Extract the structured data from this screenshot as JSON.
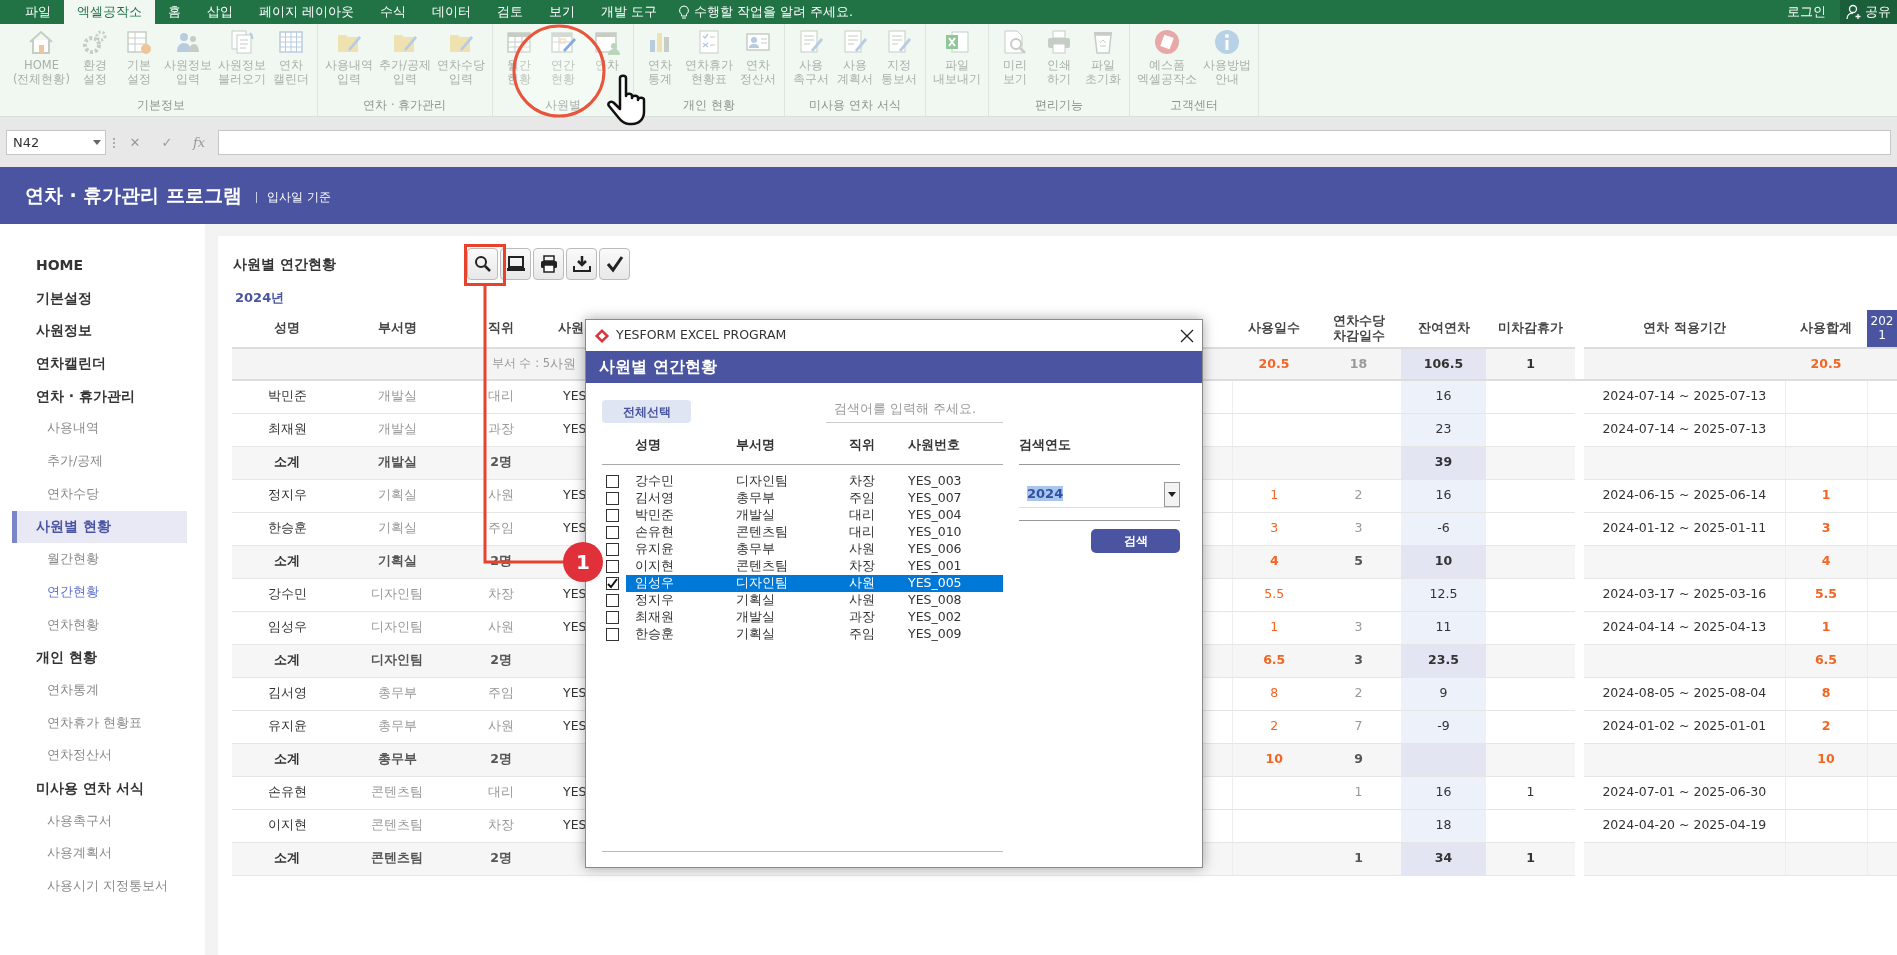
{
  "menu_bar": {
    "tabs": [
      {
        "label": "파일",
        "selected": false
      },
      {
        "label": "엑셀공작소",
        "selected": true
      },
      {
        "label": "홈",
        "selected": false
      },
      {
        "label": "삽입",
        "selected": false
      },
      {
        "label": "페이지 레이아웃",
        "selected": false
      },
      {
        "label": "수식",
        "selected": false
      },
      {
        "label": "데이터",
        "selected": false
      },
      {
        "label": "검토",
        "selected": false
      },
      {
        "label": "보기",
        "selected": false
      },
      {
        "label": "개발 도구",
        "selected": false
      }
    ],
    "tell_me": "수행할 작업을 알려 주세요.",
    "login": "로그인",
    "share": "공유"
  },
  "ribbon": {
    "groups": [
      {
        "label": "기본정보",
        "items": [
          {
            "label": "HOME\n(전체현황)"
          },
          {
            "label": "환경\n설정"
          },
          {
            "label": "기본\n설정"
          },
          {
            "label": "사원정보\n입력"
          },
          {
            "label": "사원정보\n불러오기"
          },
          {
            "label": "연차\n캘린더"
          }
        ]
      },
      {
        "label": "연차 · 휴가관리",
        "items": [
          {
            "label": "사용내역\n입력"
          },
          {
            "label": "추가/공제\n입력"
          },
          {
            "label": "연차수당\n입력"
          }
        ]
      },
      {
        "label": "사원별",
        "items": [
          {
            "label": "월간\n현황"
          },
          {
            "label": "연간\n현황"
          },
          {
            "label": "연차"
          }
        ]
      },
      {
        "label": "개인 현황",
        "items": [
          {
            "label": "연차\n통계"
          },
          {
            "label": "연차휴가\n현황표"
          },
          {
            "label": "연차\n정산서"
          }
        ]
      },
      {
        "label": "미사용 연차 서식",
        "items": [
          {
            "label": "사용\n촉구서"
          },
          {
            "label": "사용\n계획서"
          },
          {
            "label": "지정\n통보서"
          }
        ]
      },
      {
        "items": [
          {
            "label": "파일\n내보내기"
          }
        ]
      },
      {
        "label": "편리기능",
        "items": [
          {
            "label": "미리\n보기"
          },
          {
            "label": "인쇄\n하기"
          },
          {
            "label": "파일\n초기화"
          }
        ]
      },
      {
        "label": "고객센터",
        "items": [
          {
            "label": "예스폼\n엑셀공작소"
          },
          {
            "label": "사용방법\n안내"
          }
        ]
      }
    ]
  },
  "formula_bar": {
    "name_box": "N42",
    "cancel": "✕",
    "enter": "✓",
    "function": "fx"
  },
  "header": {
    "title": "연차 · 휴가관리 프로그램",
    "subtitle": "입사일 기준"
  },
  "sidebar": {
    "items": [
      {
        "label": "HOME",
        "selected": false
      },
      {
        "label": "기본설정",
        "selected": false
      },
      {
        "label": "사원정보",
        "selected": false
      },
      {
        "label": "연차캘린더",
        "selected": false
      },
      {
        "label": "연차 · 휴가관리",
        "selected": false,
        "children": [
          {
            "label": "사용내역",
            "selected": false
          },
          {
            "label": "추가/공제",
            "selected": false
          },
          {
            "label": "연차수당",
            "selected": false
          }
        ]
      },
      {
        "label": "사원별 현황",
        "selected": true,
        "children": [
          {
            "label": "월간현황",
            "selected": false
          },
          {
            "label": "연간현황",
            "selected": true
          },
          {
            "label": "연차현황",
            "selected": false
          }
        ]
      },
      {
        "label": "개인 현황",
        "selected": false,
        "children": [
          {
            "label": "연차통계",
            "selected": false
          },
          {
            "label": "연차휴가 현황표",
            "selected": false
          },
          {
            "label": "연차정산서",
            "selected": false
          }
        ]
      },
      {
        "label": "미사용 연차 서식",
        "selected": false,
        "children": [
          {
            "label": "사용촉구서",
            "selected": false
          },
          {
            "label": "사용계획서",
            "selected": false
          },
          {
            "label": "사용시기 지정통보서",
            "selected": false
          }
        ]
      }
    ]
  },
  "page": {
    "title": "사원별 연간현황",
    "year": "2024년"
  },
  "table": {
    "columns": [
      {
        "label": "성명"
      },
      {
        "label": "부서명"
      },
      {
        "label": "직위"
      },
      {
        "label": "사원"
      },
      {
        "label": "사용일수"
      },
      {
        "label": "연차수당\n차감일수"
      },
      {
        "label": "잔여연차"
      },
      {
        "label": "미차감휴가"
      },
      {
        "label": "연차 적용기간"
      },
      {
        "label": "사용합계"
      },
      {
        "label": "202\n1"
      }
    ],
    "summary": {
      "dept_count": "부서 수 : 5",
      "emp_count": "사원",
      "used": "20.5",
      "allowance": "18",
      "remaining": "106.5",
      "undeducted": "1",
      "total": "20.5"
    },
    "rows": [
      {
        "kind": "employee",
        "name": "박민준",
        "dept": "개발실",
        "position": "대리",
        "emp_no": "YES",
        "remaining": "16",
        "period": "2024-07-14 ~ 2025-07-13"
      },
      {
        "kind": "employee",
        "name": "최재원",
        "dept": "개발실",
        "position": "과장",
        "emp_no": "YES",
        "remaining": "23",
        "period": "2024-07-14 ~ 2025-07-13"
      },
      {
        "kind": "subtotal",
        "name": "소계",
        "dept": "개발실",
        "position": "2명",
        "remaining": "39"
      },
      {
        "kind": "employee",
        "name": "정지우",
        "dept": "기획실",
        "position": "사원",
        "emp_no": "YES",
        "used": "1",
        "allowance": "2",
        "remaining": "16",
        "period": "2024-06-15 ~ 2025-06-14",
        "total": "1"
      },
      {
        "kind": "employee",
        "name": "한승훈",
        "dept": "기획실",
        "position": "주임",
        "emp_no": "YES",
        "used": "3",
        "allowance": "3",
        "remaining": "-6",
        "period": "2024-01-12 ~ 2025-01-11",
        "total": "3"
      },
      {
        "kind": "subtotal",
        "name": "소계",
        "dept": "기획실",
        "position": "2명",
        "used": "4",
        "allowance": "5",
        "remaining": "10",
        "total": "4"
      },
      {
        "kind": "employee",
        "name": "강수민",
        "dept": "디자인팀",
        "position": "차장",
        "emp_no": "YES",
        "used": "5.5",
        "remaining": "12.5",
        "period": "2024-03-17 ~ 2025-03-16",
        "total": "5.5"
      },
      {
        "kind": "employee",
        "name": "임성우",
        "dept": "디자인팀",
        "position": "사원",
        "emp_no": "YES",
        "used": "1",
        "allowance": "3",
        "remaining": "11",
        "period": "2024-04-14 ~ 2025-04-13",
        "total": "1"
      },
      {
        "kind": "subtotal",
        "name": "소계",
        "dept": "디자인팀",
        "position": "2명",
        "used": "6.5",
        "allowance": "3",
        "remaining": "23.5",
        "total": "6.5"
      },
      {
        "kind": "employee",
        "name": "김서영",
        "dept": "총무부",
        "position": "주임",
        "emp_no": "YES",
        "used": "8",
        "allowance": "2",
        "remaining": "9",
        "period": "2024-08-05 ~ 2025-08-04",
        "total": "8"
      },
      {
        "kind": "employee",
        "name": "유지윤",
        "dept": "총무부",
        "position": "사원",
        "emp_no": "YES",
        "used": "2",
        "allowance": "7",
        "remaining": "-9",
        "period": "2024-01-02 ~ 2025-01-01",
        "total": "2"
      },
      {
        "kind": "subtotal",
        "name": "소계",
        "dept": "총무부",
        "position": "2명",
        "used": "10",
        "allowance": "9",
        "total": "10"
      },
      {
        "kind": "employee",
        "name": "손유현",
        "dept": "콘텐츠팀",
        "position": "대리",
        "emp_no": "YES",
        "allowance": "1",
        "remaining": "16",
        "undeducted": "1",
        "period": "2024-07-01 ~ 2025-06-30"
      },
      {
        "kind": "employee",
        "name": "이지현",
        "dept": "콘텐츠팀",
        "position": "차장",
        "emp_no": "YES",
        "remaining": "18",
        "period": "2024-04-20 ~ 2025-04-19"
      },
      {
        "kind": "subtotal",
        "name": "소계",
        "dept": "콘텐츠팀",
        "position": "2명",
        "allowance": "1",
        "remaining": "34",
        "undeducted": "1"
      }
    ]
  },
  "dialog": {
    "window_title": "YESFORM EXCEL PROGRAM",
    "header": "사원별 연간현황",
    "select_all": "전체선택",
    "search": {
      "placeholder": "검색어를 입력해 주세요."
    },
    "columns": [
      "성명",
      "부서명",
      "직위",
      "사원번호"
    ],
    "rows": [
      {
        "name": "강수민",
        "dept": "디자인팀",
        "position": "차장",
        "emp_no": "YES_003",
        "checked": false,
        "selected": false
      },
      {
        "name": "김서영",
        "dept": "총무부",
        "position": "주임",
        "emp_no": "YES_007",
        "checked": false,
        "selected": false
      },
      {
        "name": "박민준",
        "dept": "개발실",
        "position": "대리",
        "emp_no": "YES_004",
        "checked": false,
        "selected": false
      },
      {
        "name": "손유현",
        "dept": "콘텐츠팀",
        "position": "대리",
        "emp_no": "YES_010",
        "checked": false,
        "selected": false
      },
      {
        "name": "유지윤",
        "dept": "총무부",
        "position": "사원",
        "emp_no": "YES_006",
        "checked": false,
        "selected": false
      },
      {
        "name": "이지현",
        "dept": "콘텐츠팀",
        "position": "차장",
        "emp_no": "YES_001",
        "checked": false,
        "selected": false
      },
      {
        "name": "임성우",
        "dept": "디자인팀",
        "position": "사원",
        "emp_no": "YES_005",
        "checked": true,
        "selected": true
      },
      {
        "name": "정지우",
        "dept": "기획실",
        "position": "사원",
        "emp_no": "YES_008",
        "checked": false,
        "selected": false
      },
      {
        "name": "최재원",
        "dept": "개발실",
        "position": "과장",
        "emp_no": "YES_002",
        "checked": false,
        "selected": false
      },
      {
        "name": "한승훈",
        "dept": "기획실",
        "position": "주임",
        "emp_no": "YES_009",
        "checked": false,
        "selected": false
      }
    ],
    "year_label": "검색연도",
    "year": {
      "value": "2024"
    },
    "search_button": "검색"
  },
  "annotation": {
    "badge": "1"
  }
}
